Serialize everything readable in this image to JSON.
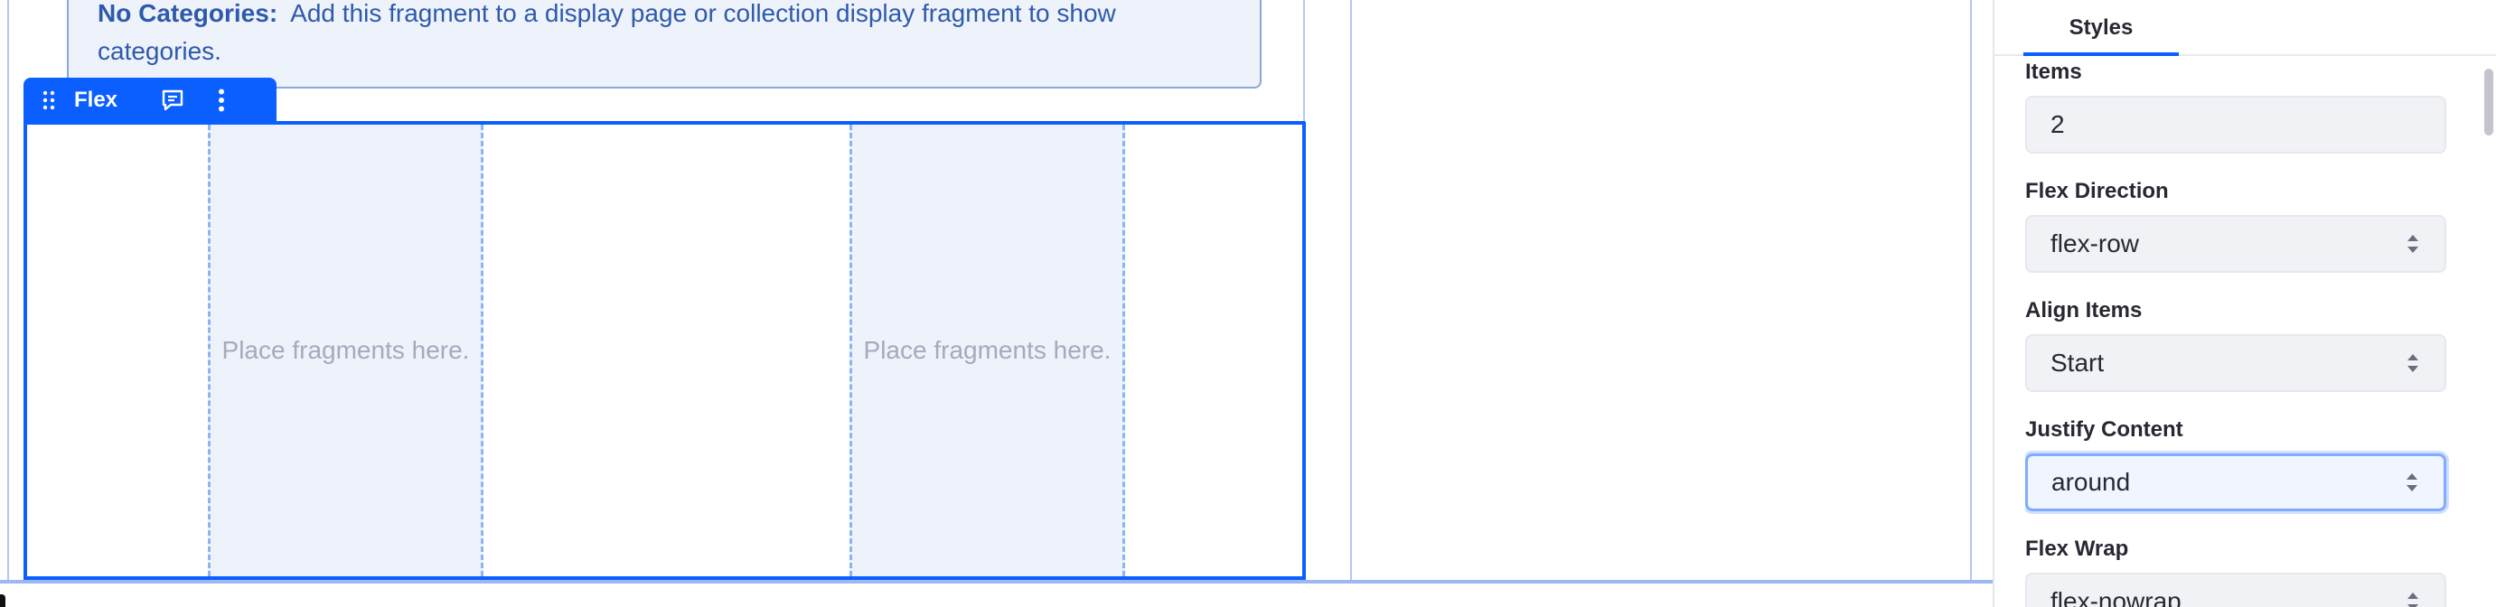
{
  "canvas": {
    "alert": {
      "title": "No Categories:",
      "message": "Add this fragment to a display page or collection display fragment to show categories."
    },
    "flex_fragment": {
      "label": "Flex",
      "drop_zones": [
        {
          "text": "Place fragments here."
        },
        {
          "text": "Place fragments here."
        }
      ]
    }
  },
  "sidebar": {
    "tab_label": "Styles",
    "fields": {
      "items": {
        "label": "Items",
        "value": "2"
      },
      "flex_direction": {
        "label": "Flex Direction",
        "value": "flex-row"
      },
      "align_items": {
        "label": "Align Items",
        "value": "Start"
      },
      "justify_content": {
        "label": "Justify Content",
        "value": "around"
      },
      "flex_wrap": {
        "label": "Flex Wrap",
        "value": "flex-nowrap"
      }
    }
  },
  "icons": {
    "drag": "drag-handle-icon",
    "comment": "comment-icon",
    "options": "vertical-ellipsis-icon",
    "select_caret": "caret-double-icon"
  },
  "colors": {
    "accent": "#0b5fff",
    "alert_bg": "#eef2fa",
    "alert_text": "#2e5aac",
    "drop_zone_bg": "#eef2fa",
    "drop_zone_border": "#8ab4f8"
  }
}
